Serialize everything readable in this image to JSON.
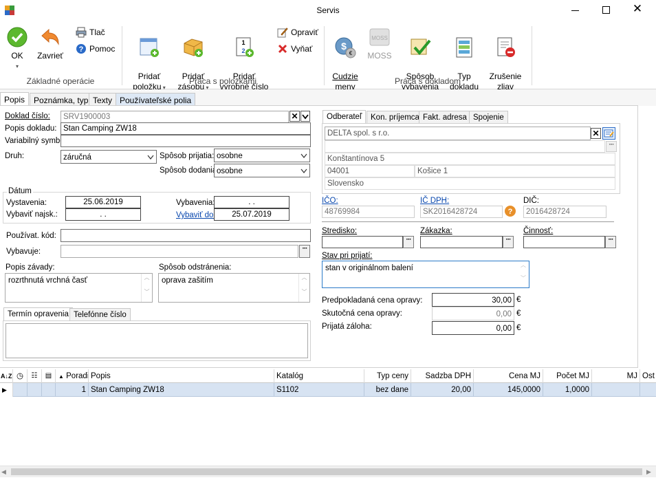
{
  "window": {
    "title": "Servis"
  },
  "ribbon": {
    "ok": "OK",
    "close": "Zavrieť",
    "print": "Tlač",
    "help": "Pomoc",
    "group_basic": "Základné operácie",
    "add_item": "Pridať\npoložku",
    "add_stock": "Pridať\nzásobu",
    "add_serial": "Pridať\nvýrobné číslo",
    "edit": "Opraviť",
    "cut": "Vyňať",
    "group_items": "Práca s položkami",
    "foreign": "Cudzie\nmeny",
    "moss": "MOSS",
    "settle": "Spôsob\nvybavenia",
    "doctype": "Typ\ndokladu",
    "cancel_disc": "Zrušenie\nzliav",
    "group_doc": "Práca s dokladom"
  },
  "tabs": [
    "Popis",
    "Poznámka, typ",
    "Texty",
    "Používateľské polia"
  ],
  "form": {
    "doc_no_label": "Doklad číslo:",
    "doc_no": "SRV1900003",
    "doc_desc_label": "Popis dokladu:",
    "doc_desc": "Stan Camping ZW18",
    "var_sym_label": "Variabilný symbol:",
    "var_sym": "",
    "kind_label": "Druh:",
    "kind": "záručná",
    "recv_label": "Spôsob prijatia:",
    "recv": "osobne",
    "deliv_label": "Spôsob dodania:",
    "deliv": "osobne",
    "date_group": "Dátum",
    "issued_label": "Vystavenia:",
    "issued": "25.06.2019",
    "earliest_label": "Vybaviť najsk.:",
    "earliest": ".   .",
    "settled_label": "Vybavenia:",
    "settled": ".   .",
    "due_label": "Vybaviť do:",
    "due": "25.07.2019",
    "usercode_label": "Používat. kód:",
    "usercode": "",
    "handler_label": "Vybavuje:",
    "handler": "",
    "fault_label": "Popis závady:",
    "fault": "rozrthnutá vrchná časť",
    "fix_label": "Spôsob odstránenia:",
    "fix": "oprava zašitím",
    "subtabs": [
      "Termín opravenia",
      "Telefónne číslo"
    ]
  },
  "partner": {
    "tabs": [
      "Odberateľ",
      "Kon. príjemca",
      "Fakt. adresa",
      "Spojenie"
    ],
    "name": "DELTA spol. s r.o.",
    "street": "Konštantínova 5",
    "zip": "04001",
    "city": "Košice 1",
    "country": "Slovensko",
    "ico_label": "IČO:",
    "ico": "48769984",
    "icdph_label": "IČ DPH:",
    "icdph": "SK2016428724",
    "dic_label": "DIČ:",
    "dic": "2016428724",
    "center_label": "Stredisko:",
    "order_label": "Zákazka:",
    "activity_label": "Činnosť:",
    "state_label": "Stav pri prijatí:",
    "state": "stan v originálnom balení",
    "est_label": "Predpokladaná cena opravy:",
    "est": "30,00",
    "real_label": "Skutočná cena opravy:",
    "real": "0,00",
    "adv_label": "Prijatá záloha:",
    "adv": "0,00",
    "currency": "€"
  },
  "grid": {
    "headers": [
      "Poradie",
      "Popis",
      "Katalóg",
      "Typ ceny",
      "Sadzba DPH",
      "Cena MJ",
      "Počet MJ",
      "MJ",
      "Ost"
    ],
    "rows": [
      {
        "order": "1",
        "desc": "Stan Camping ZW18",
        "catalog": "S1102",
        "price_type": "bez dane",
        "vat": "20,00",
        "unit_price": "145,0000",
        "qty": "1,0000",
        "unit": ""
      }
    ]
  }
}
